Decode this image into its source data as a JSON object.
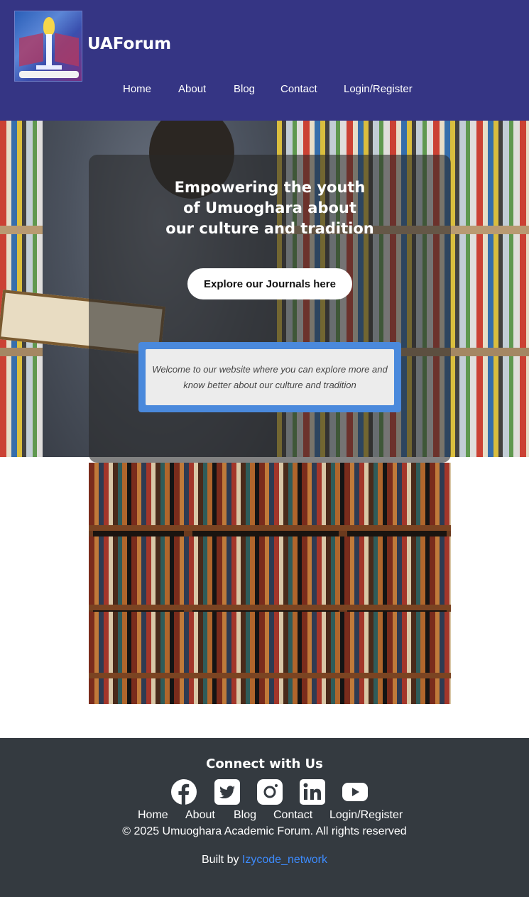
{
  "header": {
    "brand": "UAForum",
    "logo_icon": "candle-book-crest-icon",
    "background": "#353584",
    "nav": [
      {
        "label": "Home"
      },
      {
        "label": "About"
      },
      {
        "label": "Blog"
      },
      {
        "label": "Contact"
      },
      {
        "label": "Login/Register"
      }
    ]
  },
  "hero": {
    "title_lines": [
      "Empowering the youth",
      "of Umuoghara about",
      "our culture and tradition"
    ],
    "cta_label": "Explore our Journals here",
    "welcome_text": "Welcome to our website where you can explore more and know better about our culture and tradition",
    "welcome_border_color": "#4a89dc"
  },
  "footer": {
    "heading": "Connect with Us",
    "socials": [
      {
        "icon": "facebook-icon"
      },
      {
        "icon": "twitter-icon"
      },
      {
        "icon": "instagram-icon"
      },
      {
        "icon": "linkedin-icon"
      },
      {
        "icon": "youtube-icon"
      }
    ],
    "nav": [
      {
        "label": "Home"
      },
      {
        "label": "About"
      },
      {
        "label": "Blog"
      },
      {
        "label": "Contact"
      },
      {
        "label": "Login/Register"
      }
    ],
    "copyright": "© 2025 Umuoghara Academic Forum. All rights reserved",
    "built_prefix": "Built by",
    "built_link": "Izycode_network",
    "link_color": "#3d8bfd",
    "background": "#343a40"
  }
}
